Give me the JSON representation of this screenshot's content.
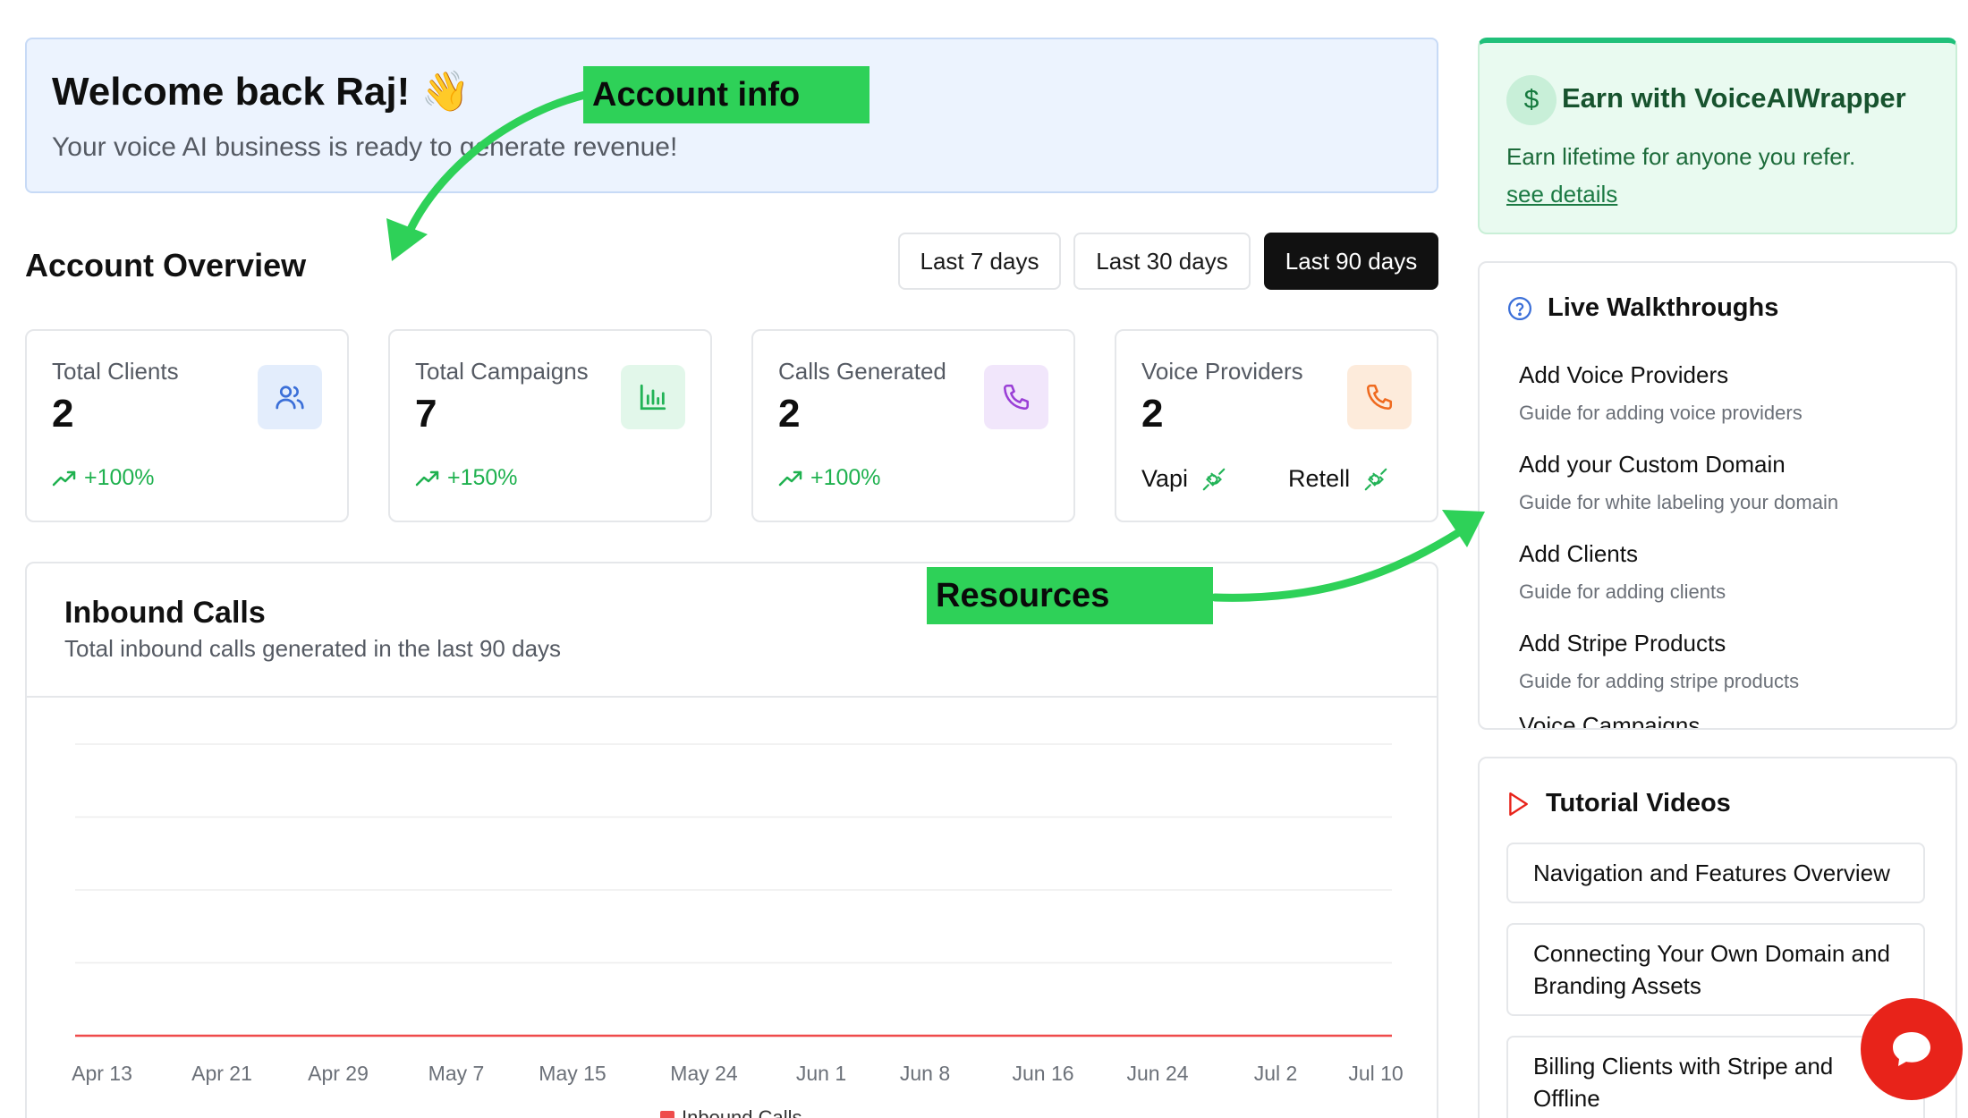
{
  "welcome": {
    "title": "Welcome back Raj! 👋",
    "subtitle": "Your voice AI business is ready to generate revenue!"
  },
  "annotations": {
    "account_info": "Account info",
    "resources": "Resources"
  },
  "overview": {
    "title": "Account Overview",
    "ranges": [
      "Last 7 days",
      "Last 30 days",
      "Last 90 days"
    ],
    "selected_range": "Last 90 days"
  },
  "stats": [
    {
      "label": "Total Clients",
      "value": "2",
      "trend": "+100%",
      "icon": "users-icon",
      "icon_bg": "#e3edfc",
      "icon_color": "#3b6fd8"
    },
    {
      "label": "Total Campaigns",
      "value": "7",
      "trend": "+150%",
      "icon": "bar-chart-icon",
      "icon_bg": "#e2f7ea",
      "icon_color": "#22b357"
    },
    {
      "label": "Calls Generated",
      "value": "2",
      "trend": "+100%",
      "icon": "phone-icon",
      "icon_bg": "#f1e6fb",
      "icon_color": "#9a3fd6"
    },
    {
      "label": "Voice Providers",
      "value": "2",
      "providers": [
        "Vapi",
        "Retell"
      ],
      "icon": "phone-icon",
      "icon_bg": "#fdebdb",
      "icon_color": "#ef6a1f"
    }
  ],
  "inbound": {
    "title": "Inbound Calls",
    "subtitle": "Total inbound calls generated in the last 90 days"
  },
  "chart_data": {
    "type": "line",
    "categories": [
      "Apr 13",
      "Apr 21",
      "Apr 29",
      "May 7",
      "May 15",
      "May 24",
      "Jun 1",
      "Jun 8",
      "Jun 16",
      "Jun 24",
      "Jul 2",
      "Jul 10"
    ],
    "series": [
      {
        "name": "Inbound Calls",
        "values": [
          0,
          0,
          0,
          0,
          0,
          0,
          0,
          0,
          0,
          0,
          0,
          0
        ],
        "color": "#ef4b4b"
      }
    ],
    "title": "Inbound Calls",
    "xlabel": "",
    "ylabel": "",
    "grid": true,
    "legend": "bottom"
  },
  "earn": {
    "title": "Earn with VoiceAIWrapper",
    "description": "Earn lifetime for anyone you refer.",
    "link": "see details"
  },
  "walkthroughs": {
    "title": "Live Walkthroughs",
    "items": [
      {
        "title": "Add Voice Providers",
        "desc": "Guide for adding voice providers"
      },
      {
        "title": "Add your Custom Domain",
        "desc": "Guide for white labeling your domain"
      },
      {
        "title": "Add Clients",
        "desc": "Guide for adding clients"
      },
      {
        "title": "Add Stripe Products",
        "desc": "Guide for adding stripe products"
      },
      {
        "title": "Voice Campaigns",
        "desc": ""
      }
    ]
  },
  "tutorials": {
    "title": "Tutorial Videos",
    "items": [
      "Navigation and Features Overview",
      "Connecting Your Own Domain and Branding Assets",
      "Billing Clients with Stripe and Offline"
    ]
  },
  "colors": {
    "accent_green": "#2ed158",
    "trend_green": "#1fb14f",
    "dark_button": "#111111",
    "chat_red": "#e8231a"
  }
}
